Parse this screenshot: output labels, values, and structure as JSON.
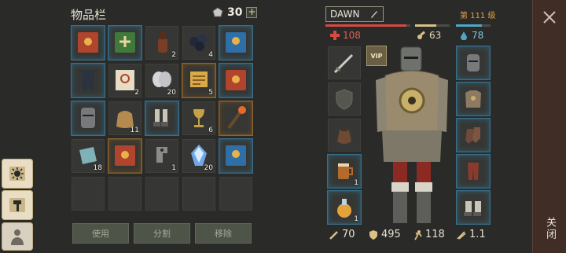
{
  "inventory": {
    "title": "物品栏",
    "currency_value": "30",
    "currency_plus": "+",
    "slots": [
      {
        "item": "red-book-icon",
        "quality": "blue",
        "count": ""
      },
      {
        "item": "green-book-icon",
        "quality": "blue",
        "count": ""
      },
      {
        "item": "bottle-icon",
        "quality": "none",
        "count": "2"
      },
      {
        "item": "coal-icon",
        "quality": "none",
        "count": "4"
      },
      {
        "item": "blue-book-icon",
        "quality": "blue",
        "count": ""
      },
      {
        "item": "dark-pants-icon",
        "quality": "blue",
        "count": ""
      },
      {
        "item": "treasure-map-icon",
        "quality": "none",
        "count": "2"
      },
      {
        "item": "cloth-roll-icon",
        "quality": "none",
        "count": "20"
      },
      {
        "item": "gold-scroll-icon",
        "quality": "gold",
        "count": "5"
      },
      {
        "item": "red-book-icon",
        "quality": "blue",
        "count": ""
      },
      {
        "item": "iron-helmet-icon",
        "quality": "blue",
        "count": ""
      },
      {
        "item": "grain-sack-icon",
        "quality": "none",
        "count": "11"
      },
      {
        "item": "boots-icon",
        "quality": "blue",
        "count": ""
      },
      {
        "item": "goblet-icon",
        "quality": "none",
        "count": "6"
      },
      {
        "item": "torch-icon",
        "quality": "gold",
        "count": ""
      },
      {
        "item": "fabric-icon",
        "quality": "none",
        "count": "18"
      },
      {
        "item": "red-book-icon",
        "quality": "gold",
        "count": ""
      },
      {
        "item": "metal-clamp-icon",
        "quality": "none",
        "count": "1"
      },
      {
        "item": "blue-crystal-icon",
        "quality": "none",
        "count": "20"
      },
      {
        "item": "blue-book-icon",
        "quality": "blue",
        "count": ""
      },
      {
        "item": "",
        "quality": "none",
        "count": ""
      },
      {
        "item": "",
        "quality": "none",
        "count": ""
      },
      {
        "item": "",
        "quality": "none",
        "count": ""
      },
      {
        "item": "",
        "quality": "none",
        "count": ""
      },
      {
        "item": "",
        "quality": "none",
        "count": ""
      }
    ],
    "buttons": {
      "use": "使用",
      "split": "分割",
      "remove": "移除"
    }
  },
  "character": {
    "name": "DAWN",
    "level": "第 111 级",
    "health": "108",
    "food": "63",
    "water": "78",
    "vip": "VIP",
    "health_fraction": 0.95,
    "food_fraction": 0.62,
    "water_fraction": 0.75,
    "consumables": [
      {
        "item": "wooden-mug-icon",
        "count": "1"
      },
      {
        "item": "potion-flask-icon",
        "count": "1"
      }
    ],
    "stats": {
      "damage": "70",
      "armor": "495",
      "speed": "118",
      "attack_speed": "1.1"
    }
  },
  "close_panel": {
    "label": "关闭"
  },
  "colors": {
    "health": "#d64a41",
    "food": "#d9c086",
    "water": "#4ea7c4",
    "level": "#e0a23c"
  }
}
